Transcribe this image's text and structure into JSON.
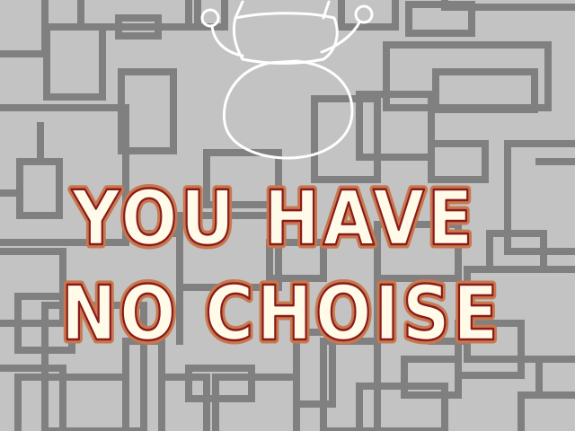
{
  "scene": {
    "message_line_1": "YOU HAVE",
    "message_line_2": "NO CHOISE",
    "colors": {
      "background": "#c3c3c3",
      "maze_lines": "#808080",
      "sketch": "#ffffff",
      "letter_fill": "#fffbe8",
      "letter_outline": "#c8784e",
      "letter_edge": "#8b1a1a"
    }
  }
}
